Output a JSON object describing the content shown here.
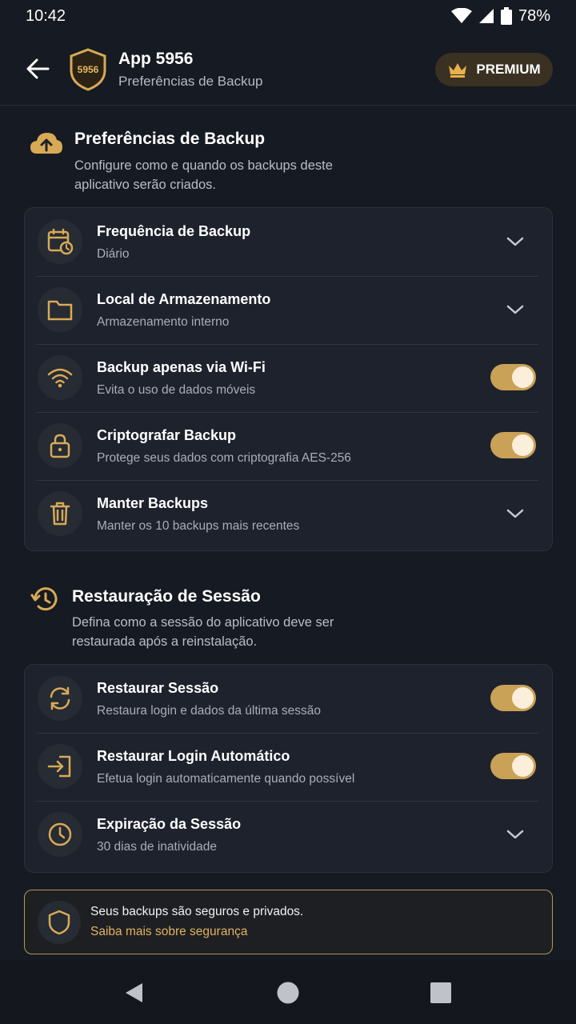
{
  "status": {
    "time": "10:42",
    "battery": "78%"
  },
  "header": {
    "app_badge_text": "5956",
    "title": "App 5956",
    "subtitle": "Preferências de Backup",
    "premium_label": "PREMIUM"
  },
  "backup_section": {
    "title": "Preferências de Backup",
    "desc_line1": "Configure como e quando os backups deste",
    "desc_line2": "aplicativo serão criados.",
    "items": [
      {
        "title": "Frequência de Backup",
        "subtitle": "Diário",
        "control": "dropdown",
        "icon": "calendar-clock-icon"
      },
      {
        "title": "Local de Armazenamento",
        "subtitle": "Armazenamento interno",
        "control": "dropdown",
        "icon": "folder-icon"
      },
      {
        "title": "Backup apenas via Wi-Fi",
        "subtitle": "Evita o uso de dados móveis",
        "control": "toggle",
        "on": true,
        "icon": "wifi-icon"
      },
      {
        "title": "Criptografar Backup",
        "subtitle": "Protege seus dados com criptografia AES-256",
        "control": "toggle",
        "on": true,
        "icon": "lock-icon"
      },
      {
        "title": "Manter Backups",
        "subtitle": "Manter os 10 backups mais recentes",
        "control": "dropdown",
        "icon": "trash-icon"
      }
    ]
  },
  "session_section": {
    "title": "Restauração de Sessão",
    "desc_line1": "Defina como a sessão do aplicativo deve ser",
    "desc_line2": "restaurada após a reinstalação.",
    "items": [
      {
        "title": "Restaurar Sessão",
        "subtitle": "Restaura login e dados da última sessão",
        "control": "toggle",
        "on": true,
        "icon": "refresh-icon"
      },
      {
        "title": "Restaurar Login Automático",
        "subtitle": "Efetua login automaticamente quando possível",
        "control": "toggle",
        "on": true,
        "icon": "login-icon"
      },
      {
        "title": "Expiração da Sessão",
        "subtitle": "30 dias de inatividade",
        "control": "dropdown",
        "icon": "clock-icon"
      }
    ]
  },
  "security_note": {
    "text": "Seus backups são seguros e privados.",
    "link": "Saiba mais sobre segurança"
  },
  "colors": {
    "accent": "#e0b35e",
    "toggle_on": "#c9a157",
    "background": "#161a22",
    "card": "#1d222c"
  }
}
